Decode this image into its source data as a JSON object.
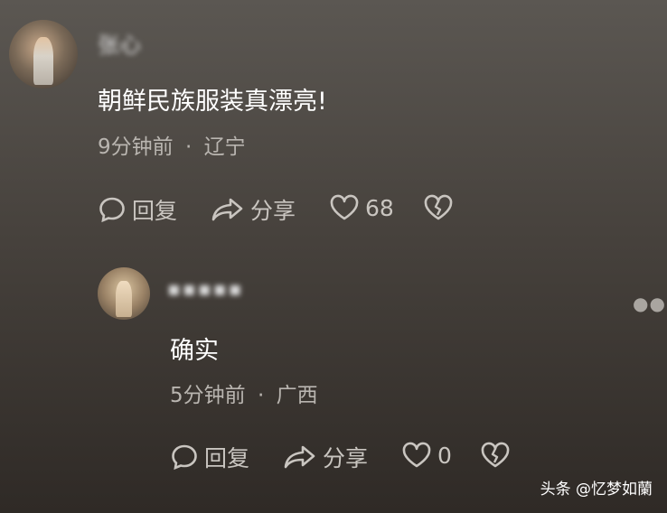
{
  "comment": {
    "username": "张心",
    "text": "朝鲜民族服装真漂亮!",
    "time": "9分钟前",
    "separator": "·",
    "location": "辽宁",
    "reply_label": "回复",
    "share_label": "分享",
    "like_count": "68"
  },
  "reply": {
    "username": "▪▪▪▪▪",
    "text": "确实",
    "time": "5分钟前",
    "separator": "·",
    "location": "广西",
    "reply_label": "回复",
    "share_label": "分享",
    "like_count": "0"
  },
  "watermark": "头条 @忆梦如蘭",
  "icons": [
    "comment-bubble-icon",
    "share-arrow-icon",
    "heart-icon",
    "broken-heart-icon",
    "more-dots-icon"
  ],
  "colors": {
    "background_top": "#5b5752",
    "background_bottom": "#2f2a26",
    "text": "#ffffff",
    "meta": "#b9b5b0"
  }
}
